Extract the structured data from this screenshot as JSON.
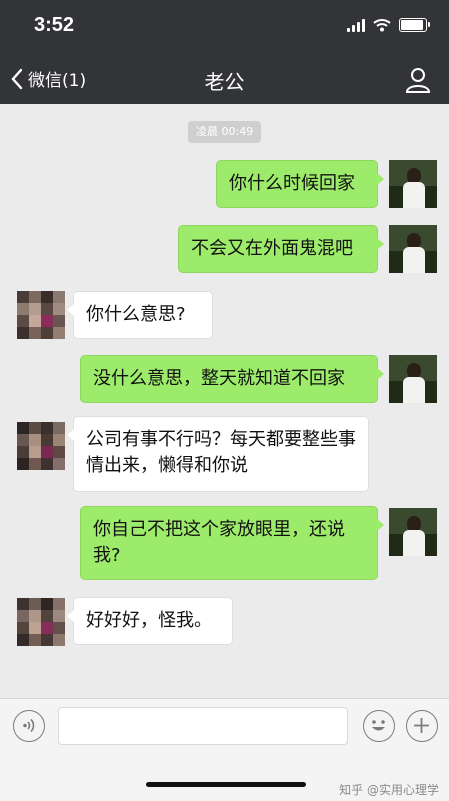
{
  "status_bar": {
    "time": "3:52",
    "battery_level": 0.85
  },
  "nav": {
    "back_label": "微信(1)",
    "title": "老公"
  },
  "chat": {
    "timestamp": "凌晨 00:49",
    "messages": [
      {
        "sender": "me",
        "text": "你什么时候回家"
      },
      {
        "sender": "me",
        "text": "不会又在外面鬼混吧"
      },
      {
        "sender": "other",
        "text": "你什么意思?"
      },
      {
        "sender": "me",
        "text": "没什么意思，整天就知道不回家"
      },
      {
        "sender": "other",
        "text": "公司有事不行吗？每天都要整些事情出来，懒得和你说"
      },
      {
        "sender": "me",
        "text": "你自己不把这个家放眼里，还说我?"
      },
      {
        "sender": "other",
        "text": "好好好，怪我。"
      }
    ]
  },
  "input_bar": {
    "watermark": "知乎 @实用心理学"
  },
  "colors": {
    "header_bg": "#333437",
    "chat_bg": "#ebebeb",
    "my_bubble": "#9deb6a",
    "other_bubble": "#ffffff"
  },
  "icons": {
    "back": "chevron-left-icon",
    "profile": "person-icon",
    "voice": "voice-icon",
    "emoji": "emoji-icon",
    "more": "plus-icon",
    "wifi": "wifi-icon",
    "signal": "signal-icon",
    "battery": "battery-icon"
  }
}
